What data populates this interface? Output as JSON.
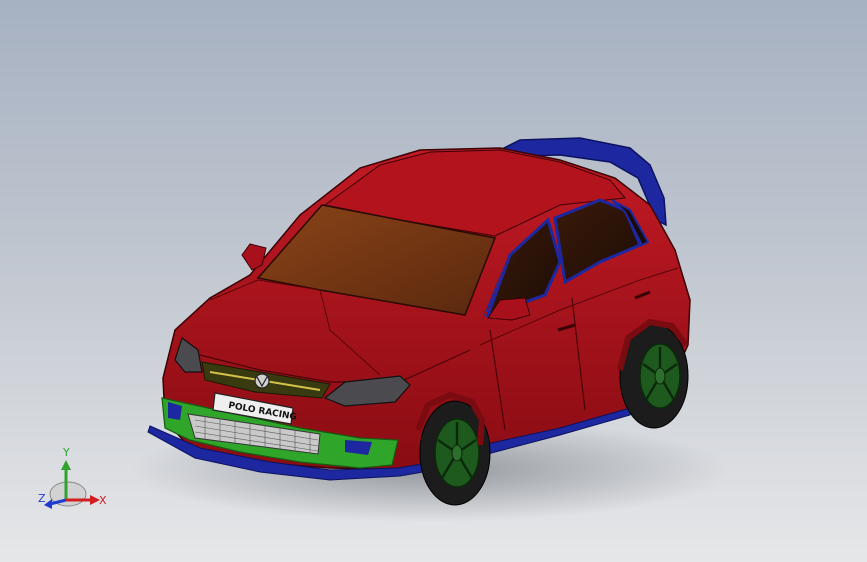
{
  "model": {
    "name": "",
    "plate_text": "POLO RACING",
    "colors": {
      "body": "#b3131d",
      "body_dark": "#7a0b11",
      "glass": "#6e3414",
      "spoiler": "#1d28a0",
      "bumper_trim": "#2fa52a",
      "grille_mesh": "#d9d9d9",
      "tire": "#1c1c1c",
      "wheel": "#1e5a1e"
    }
  },
  "triad": {
    "x_label": "X",
    "y_label": "Y",
    "z_label": "Z",
    "colors": {
      "x": "#d21e1e",
      "y": "#2ea32e",
      "z": "#1f3bd1"
    }
  }
}
